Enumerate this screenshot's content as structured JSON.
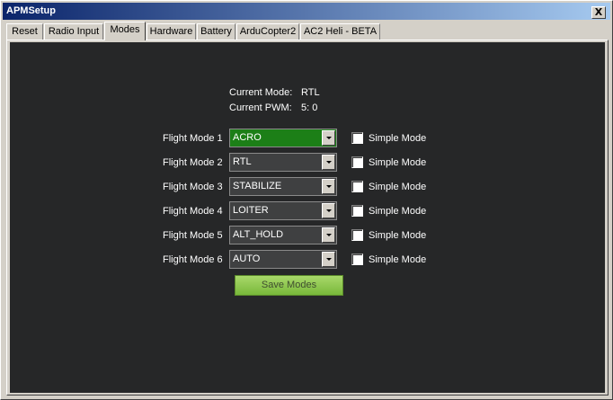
{
  "window": {
    "title": "APMSetup",
    "close_label": "X"
  },
  "tabs": [
    {
      "label": "Reset"
    },
    {
      "label": "Radio Input"
    },
    {
      "label": "Modes"
    },
    {
      "label": "Hardware"
    },
    {
      "label": "Battery"
    },
    {
      "label": "ArduCopter2"
    },
    {
      "label": "AC2 Heli - BETA"
    }
  ],
  "active_tab": "Modes",
  "status": {
    "current_mode_label": "Current Mode:",
    "current_mode_value": "RTL",
    "current_pwm_label": "Current PWM:",
    "current_pwm_value": "5: 0"
  },
  "flight_modes": [
    {
      "label": "Flight Mode 1",
      "value": "ACRO",
      "simple_label": "Simple Mode",
      "simple_checked": false
    },
    {
      "label": "Flight Mode 2",
      "value": "RTL",
      "simple_label": "Simple Mode",
      "simple_checked": false
    },
    {
      "label": "Flight Mode 3",
      "value": "STABILIZE",
      "simple_label": "Simple Mode",
      "simple_checked": false
    },
    {
      "label": "Flight Mode 4",
      "value": "LOITER",
      "simple_label": "Simple Mode",
      "simple_checked": false
    },
    {
      "label": "Flight Mode 5",
      "value": "ALT_HOLD",
      "simple_label": "Simple Mode",
      "simple_checked": false
    },
    {
      "label": "Flight Mode 6",
      "value": "AUTO",
      "simple_label": "Simple Mode",
      "simple_checked": false
    }
  ],
  "save_button_label": "Save Modes",
  "colors": {
    "panel_bg": "#262728",
    "selected_mode_bg": "#1c7f17",
    "save_button": "#8fcb4f",
    "titlebar": "#0a246a"
  }
}
